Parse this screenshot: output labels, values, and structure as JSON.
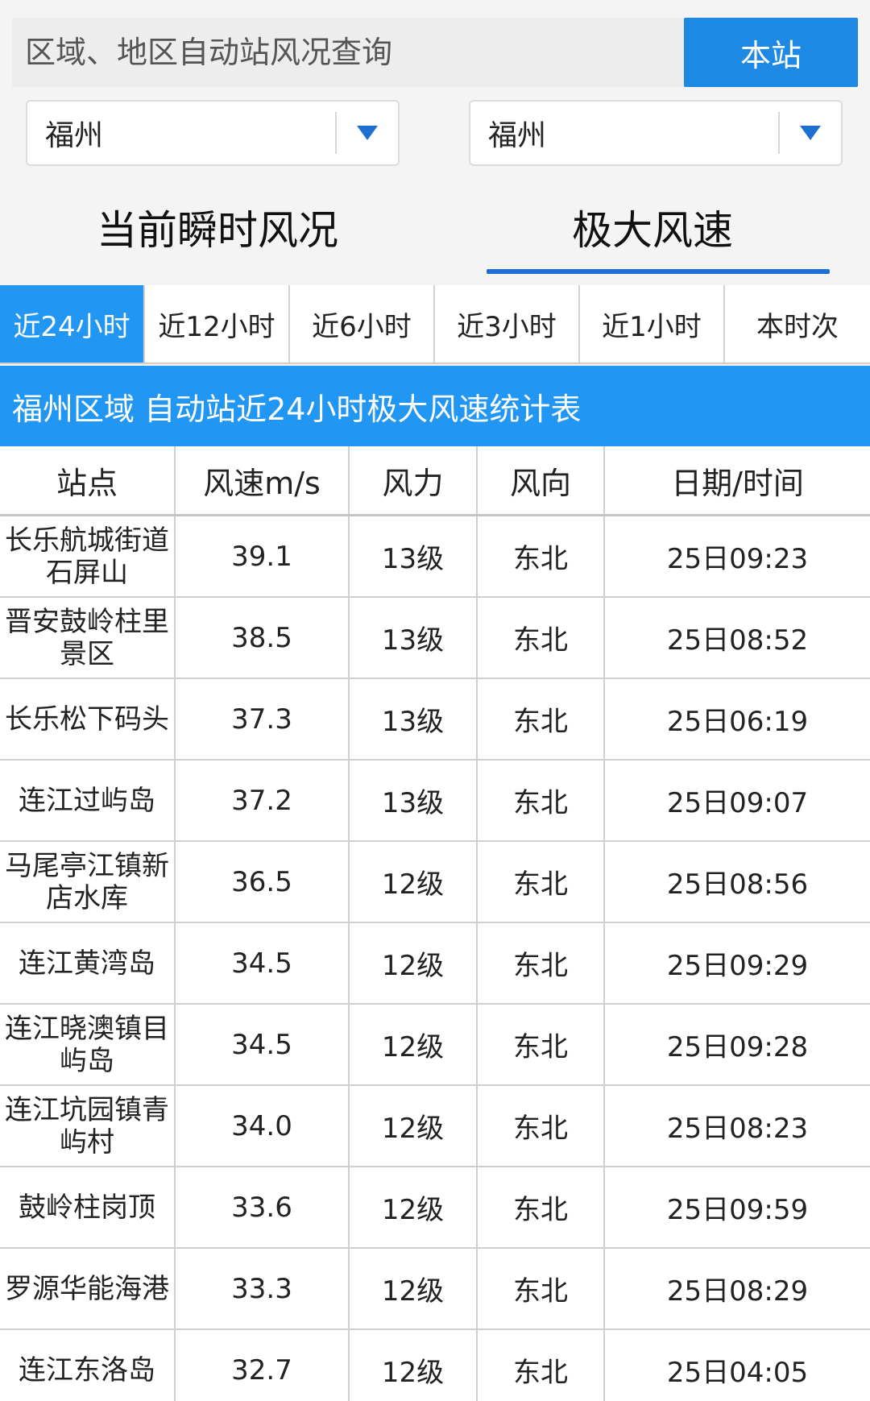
{
  "search": {
    "placeholder": "区域、地区自动站风况查询",
    "button_label": "本站"
  },
  "selects": {
    "left_value": "福州",
    "right_value": "福州"
  },
  "main_tabs": [
    {
      "label": "当前瞬时风况",
      "active": false
    },
    {
      "label": "极大风速",
      "active": true
    }
  ],
  "period_tabs": [
    {
      "label": "近24小时",
      "active": true
    },
    {
      "label": "近12小时",
      "active": false
    },
    {
      "label": "近6小时",
      "active": false
    },
    {
      "label": "近3小时",
      "active": false
    },
    {
      "label": "近1小时",
      "active": false
    },
    {
      "label": "本时次",
      "active": false
    }
  ],
  "title": "福州区域 自动站近24小时极大风速统计表",
  "table": {
    "headers": [
      "站点",
      "风速m/s",
      "风力",
      "风向",
      "日期/时间"
    ],
    "rows": [
      [
        "长乐航城街道石屏山",
        "39.1",
        "13级",
        "东北",
        "25日09:23"
      ],
      [
        "晋安鼓岭柱里景区",
        "38.5",
        "13级",
        "东北",
        "25日08:52"
      ],
      [
        "长乐松下码头",
        "37.3",
        "13级",
        "东北",
        "25日06:19"
      ],
      [
        "连江过屿岛",
        "37.2",
        "13级",
        "东北",
        "25日09:07"
      ],
      [
        "马尾亭江镇新店水库",
        "36.5",
        "12级",
        "东北",
        "25日08:56"
      ],
      [
        "连江黄湾岛",
        "34.5",
        "12级",
        "东北",
        "25日09:29"
      ],
      [
        "连江晓澳镇目屿岛",
        "34.5",
        "12级",
        "东北",
        "25日09:28"
      ],
      [
        "连江坑园镇青屿村",
        "34.0",
        "12级",
        "东北",
        "25日08:23"
      ],
      [
        "鼓岭柱岗顶",
        "33.6",
        "12级",
        "东北",
        "25日09:59"
      ],
      [
        "罗源华能海港",
        "33.3",
        "12级",
        "东北",
        "25日08:29"
      ],
      [
        "连江东洛岛",
        "32.7",
        "12级",
        "东北",
        "25日04:05"
      ]
    ]
  },
  "colors": {
    "accent": "#2196f3",
    "button": "#1e88e5",
    "dropdown_arrow": "#1e6fcf"
  },
  "icons": {
    "dropdown": "triangle-down-icon"
  }
}
